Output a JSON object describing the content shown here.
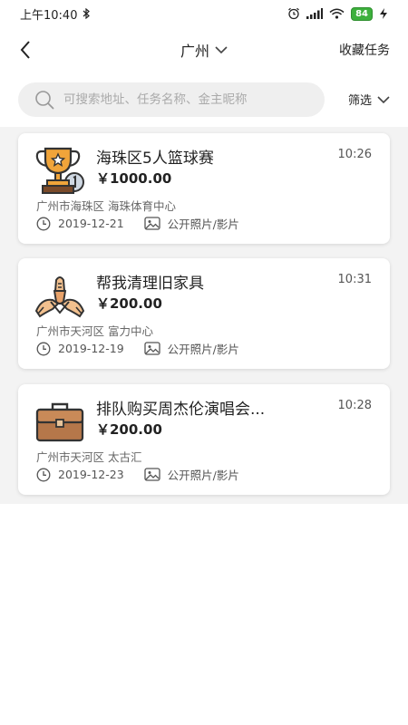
{
  "status_bar": {
    "time": "上午10:40",
    "battery": "84"
  },
  "nav": {
    "city": "广州",
    "favorites_label": "收藏任务"
  },
  "search": {
    "placeholder": "可搜索地址、任务名称、金主昵称",
    "value": ""
  },
  "filter": {
    "label": "筛选"
  },
  "tasks": [
    {
      "icon": "trophy-icon",
      "title": "海珠区5人篮球赛",
      "time": "10:26",
      "price": "￥1000.00",
      "address": "广州市海珠区 海珠体育中心",
      "date": "2019-12-21",
      "media": "公开照片/影片"
    },
    {
      "icon": "hands-icon",
      "title": "帮我清理旧家具",
      "time": "10:31",
      "price": "￥200.00",
      "address": "广州市天河区 富力中心",
      "date": "2019-12-19",
      "media": "公开照片/影片"
    },
    {
      "icon": "briefcase-icon",
      "title": "排队购买周杰伦演唱会...",
      "time": "10:28",
      "price": "￥200.00",
      "address": "广州市天河区 太古汇",
      "date": "2019-12-23",
      "media": "公开照片/影片"
    }
  ],
  "colors": {
    "list_background": "#f3f3f3",
    "search_background": "#efefef",
    "battery": "#3db03d"
  }
}
